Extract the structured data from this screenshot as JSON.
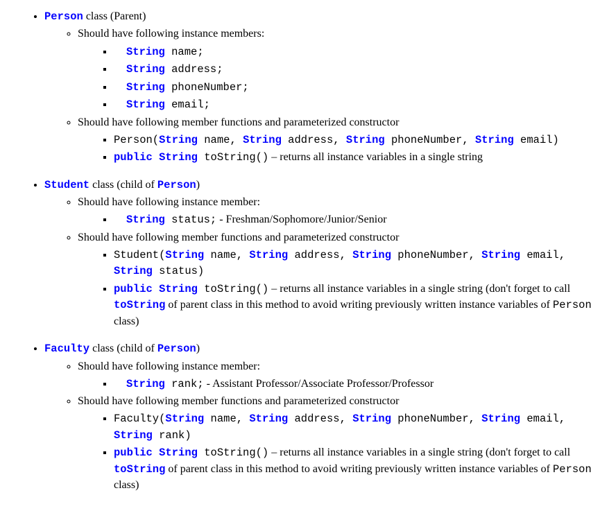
{
  "person": {
    "title_kw": "Person",
    "title_rest": " class (Parent)",
    "members_intro": "Should have following instance members:",
    "members": [
      {
        "kw": "String",
        "rest": " name;"
      },
      {
        "kw": "String",
        "rest": " address;"
      },
      {
        "kw": "String",
        "rest": " phoneNumber;"
      },
      {
        "kw": "String",
        "rest": " email;"
      }
    ],
    "funcs_intro": "Should have following member functions and parameterized constructor",
    "ctor_pre": "Person(",
    "ctor_rest1": " name, ",
    "ctor_rest2": " address, ",
    "ctor_rest3": " phoneNumber, ",
    "ctor_rest4": " email)",
    "toString_pre": "public String",
    "toString_mid": " toString()",
    "toString_dash": " –  ",
    "toString_rest": "returns all instance variables in a single string"
  },
  "student": {
    "title_kw": "Student",
    "title_rest_a": " class (child of ",
    "title_rest_kw": "Person",
    "title_rest_b": ")",
    "members_intro": "Should have following instance member:",
    "member_kw": "String",
    "member_rest": " status;",
    "member_desc": "  - Freshman/Sophomore/Junior/Senior",
    "funcs_intro": "Should have following member functions and parameterized constructor",
    "ctor_pre": "Student(",
    "ctor_rest1": " name, ",
    "ctor_rest2": " address, ",
    "ctor_rest3": " phoneNumber, ",
    "ctor_rest4": " email, ",
    "ctor_rest5": " status)",
    "toString_pre": "public String",
    "toString_mid": " toString()",
    "toString_dash": " –  ",
    "toString_rest": "returns all instance variables in a single string (don't forget to call ",
    "toString_kw": "toString",
    "toString_rest2a": " of parent class in this method to avoid writing previously written instance variables of ",
    "toString_code": "Person",
    "toString_rest2b": " class)"
  },
  "faculty": {
    "title_kw": "Faculty",
    "title_rest_a": " class (child of ",
    "title_rest_kw": "Person",
    "title_rest_b": ")",
    "members_intro": "Should have following instance member:",
    "member_kw": "String",
    "member_rest": " rank;",
    "member_desc": "  - Assistant Professor/Associate Professor/Professor",
    "funcs_intro": "Should have following member functions and parameterized constructor",
    "ctor_pre": "Faculty(",
    "ctor_rest1": " name, ",
    "ctor_rest2": " address, ",
    "ctor_rest3": " phoneNumber, ",
    "ctor_rest4": " email, ",
    "ctor_rest5": " rank)",
    "toString_pre": "public String",
    "toString_mid": " toString()",
    "toString_dash": " –  ",
    "toString_rest": "returns all instance variables in a single string (don't forget to call ",
    "toString_kw": "toString",
    "toString_rest2a": " of parent class in this method to avoid writing previously written instance variables of ",
    "toString_code": "Person",
    "toString_rest2b": " class)"
  },
  "kw_string": "String"
}
